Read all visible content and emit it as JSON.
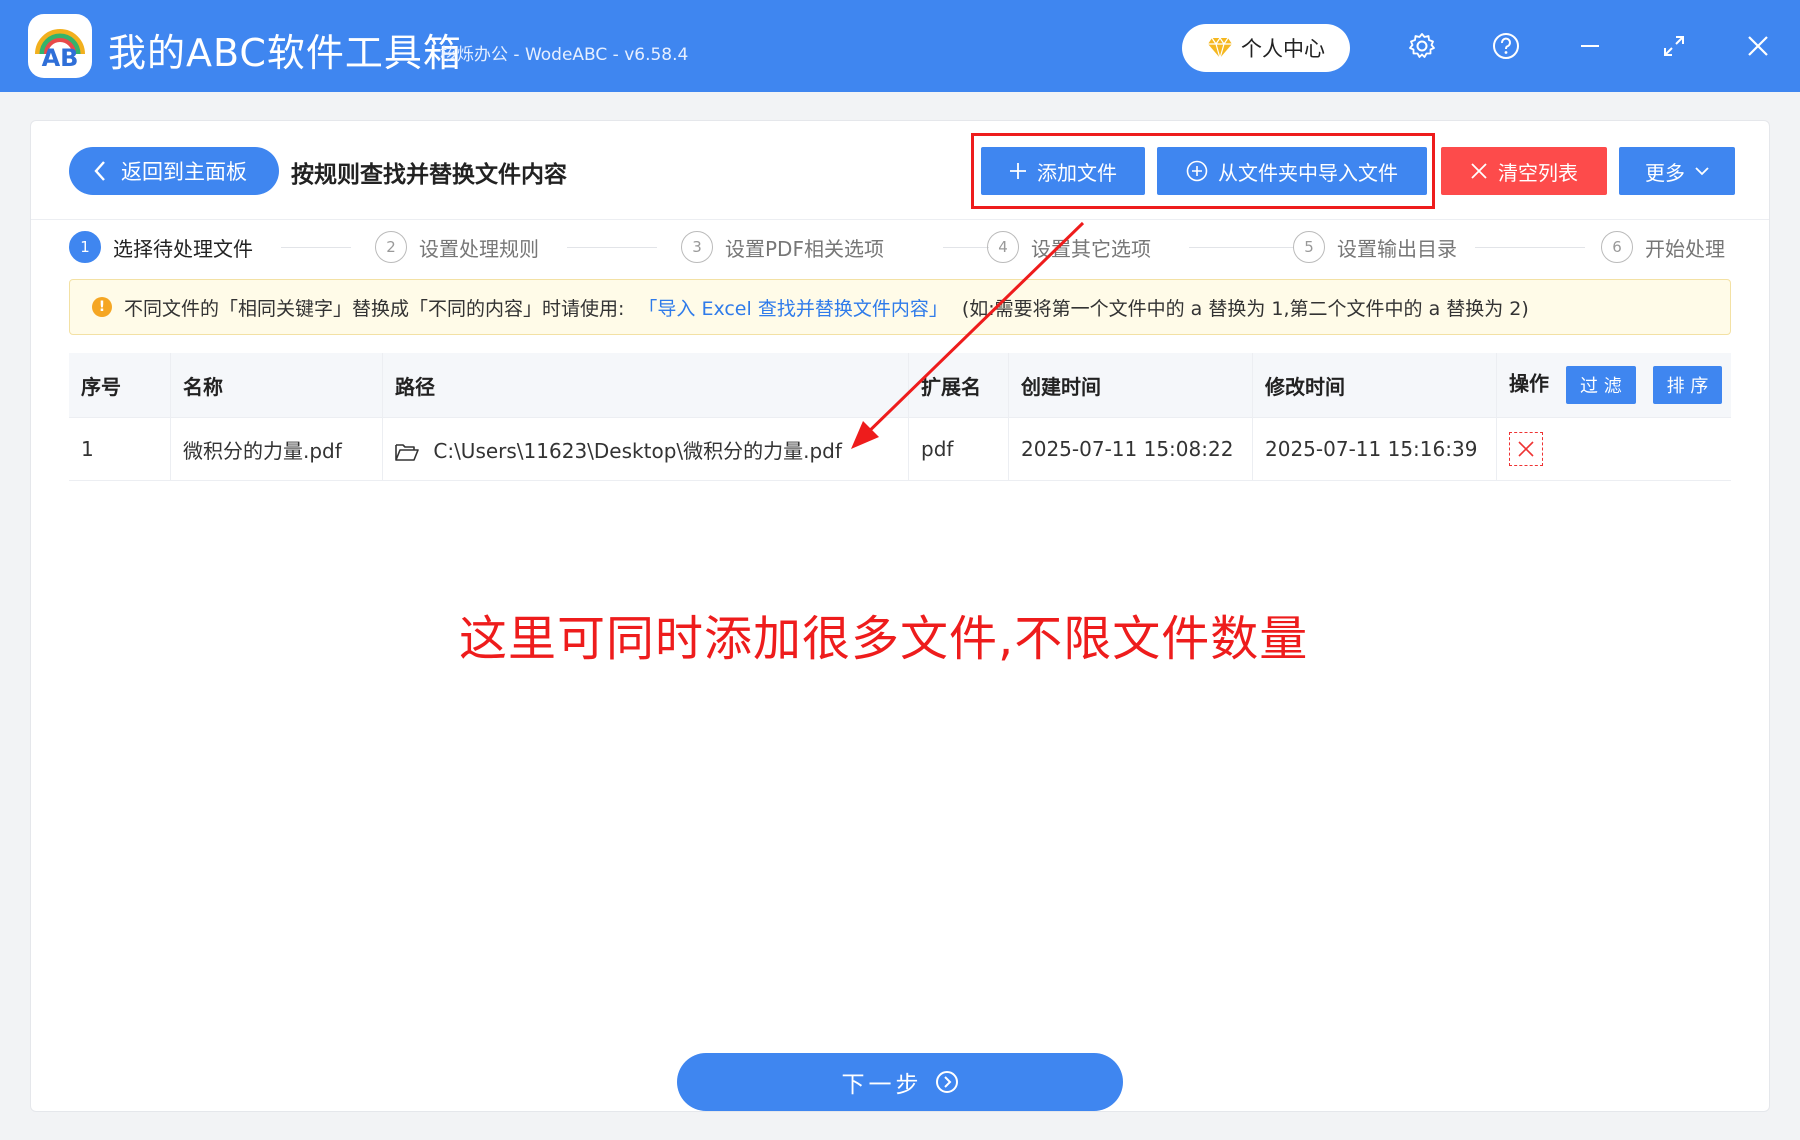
{
  "app": {
    "title": "我的ABC软件工具箱",
    "subtitle": "核烁办公 - WodeABC - v6.58.4",
    "logo_text": "AB"
  },
  "titlebar": {
    "user_center_label": "个人中心",
    "icons": [
      "diamond-icon",
      "gear-icon",
      "help-icon",
      "minimize-icon",
      "maximize-icon",
      "close-icon"
    ]
  },
  "toolbar": {
    "back_label": "返回到主面板",
    "page_title": "按规则查找并替换文件内容",
    "add_file_label": "添加文件",
    "import_folder_label": "从文件夹中导入文件",
    "clear_list_label": "清空列表",
    "more_label": "更多"
  },
  "steps": [
    {
      "num": "1",
      "label": "选择待处理文件"
    },
    {
      "num": "2",
      "label": "设置处理规则"
    },
    {
      "num": "3",
      "label": "设置PDF相关选项"
    },
    {
      "num": "4",
      "label": "设置其它选项"
    },
    {
      "num": "5",
      "label": "设置输出目录"
    },
    {
      "num": "6",
      "label": "开始处理"
    }
  ],
  "notice": {
    "text_before": "不同文件的「相同关键字」替换成「不同的内容」时请使用:",
    "link": "「导入 Excel 查找并替换文件内容」",
    "text_after": "(如:需要将第一个文件中的 a 替换为 1,第二个文件中的 a 替换为 2)"
  },
  "table": {
    "headers": {
      "index": "序号",
      "name": "名称",
      "path": "路径",
      "ext": "扩展名",
      "created": "创建时间",
      "modified": "修改时间",
      "action": "操作",
      "filter": "过 滤",
      "sort": "排 序"
    },
    "rows": [
      {
        "index": "1",
        "name": "微积分的力量.pdf",
        "path": "C:\\Users\\11623\\Desktop\\微积分的力量.pdf",
        "ext": "pdf",
        "created": "2025-07-11 15:08:22",
        "modified": "2025-07-11 15:16:39"
      }
    ]
  },
  "annotation": "这里可同时添加很多文件,不限文件数量",
  "next_label": "下一步",
  "colors": {
    "primary": "#3f86f0",
    "danger": "#fd4b4b",
    "annotation": "#ee1c1c"
  }
}
